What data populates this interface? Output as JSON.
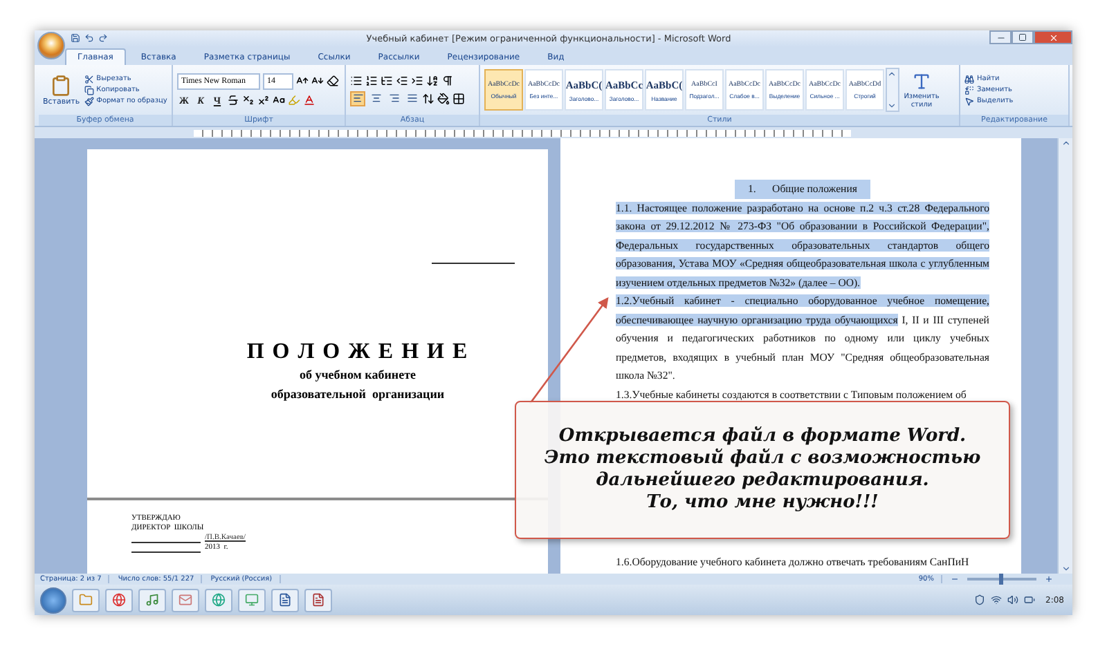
{
  "window": {
    "title": "Учебный кабинет [Режим ограниченной функциональности] - Microsoft Word"
  },
  "tabs": [
    {
      "label": "Главная",
      "selected": true
    },
    {
      "label": "Вставка",
      "selected": false
    },
    {
      "label": "Разметка страницы",
      "selected": false
    },
    {
      "label": "Ссылки",
      "selected": false
    },
    {
      "label": "Рассылки",
      "selected": false
    },
    {
      "label": "Рецензирование",
      "selected": false
    },
    {
      "label": "Вид",
      "selected": false
    }
  ],
  "ribbon": {
    "clipboard": {
      "paste": "Вставить",
      "cut": "Вырезать",
      "copy": "Копировать",
      "format_painter": "Формат по образцу",
      "label": "Буфер обмена"
    },
    "font": {
      "font_name": "Times New Roman",
      "font_size": "14",
      "bold": "Ж",
      "italic": "К",
      "underline": "Ч",
      "label": "Шрифт"
    },
    "paragraph": {
      "align_buttons": [
        {
          "kind": "left",
          "selected": true
        },
        {
          "kind": "center",
          "selected": false
        },
        {
          "kind": "right",
          "selected": false
        },
        {
          "kind": "justify",
          "selected": false
        }
      ],
      "label": "Абзац"
    },
    "styles": {
      "items": [
        {
          "preview": "AaBbCcDc",
          "name": "Обычный",
          "kind": "body",
          "selected": true
        },
        {
          "preview": "AaBbCcDc",
          "name": "Без инте...",
          "kind": "body",
          "selected": false
        },
        {
          "preview": "AaBbC(",
          "name": "Заголово...",
          "kind": "heading",
          "selected": false
        },
        {
          "preview": "AaBbCc",
          "name": "Заголово...",
          "kind": "heading",
          "selected": false
        },
        {
          "preview": "AaBbC(",
          "name": "Название",
          "kind": "heading",
          "selected": false
        },
        {
          "preview": "AaBbCcI",
          "name": "Подзагол...",
          "kind": "body",
          "selected": false
        },
        {
          "preview": "AaBbCcDc",
          "name": "Слабое в...",
          "kind": "body",
          "selected": false
        },
        {
          "preview": "AaBbCcDc",
          "name": "Выделение",
          "kind": "body",
          "selected": false
        },
        {
          "preview": "AaBbCcDc",
          "name": "Сильное ...",
          "kind": "body",
          "selected": false
        },
        {
          "preview": "AaBbCcDd",
          "name": "Строгий",
          "kind": "body",
          "selected": false
        }
      ],
      "change_styles": "Изменить стили",
      "label": "Стили"
    },
    "editing": {
      "find": "Найти",
      "replace": "Заменить",
      "select": "Выделить",
      "label": "Редактирование"
    }
  },
  "left_page": {
    "title": "П О Л О Ж Е Н И Е",
    "subtitle_lines": [
      "об учебном кабинете",
      "образовательной  организации"
    ],
    "approval_lines": [
      "УТВЕРЖДАЮ",
      "ДИРЕКТОР  ШКОЛЫ"
    ],
    "signature": "/П.В.Качаев/",
    "year": "2013  г."
  },
  "right_page": {
    "heading": "1.      Общие положения",
    "heading_selected": true,
    "paragraphs": [
      {
        "runs": [
          {
            "text": "1.1. Настоящее положение разработано на основе п.2  ч.3 ст.28  Федерального закона от 29.12.2012     № 273-ФЗ \"Об образовании в Российской Федерации\", Федеральных государственных образовательных стандартов общего образования, Устава МОУ «Средняя общеобразовательная школа с углубленным изучением отдельных предметов №32» (далее – ОО).",
            "selected": true
          }
        ]
      },
      {
        "runs": [
          {
            "text": "1.2.Учебный кабинет - специально оборудованное учебное помещение, обеспечивающее научную организацию труда обучающихся",
            "selected": true
          },
          {
            "text": " I, II и III ступеней обучения и педагогических работников по одному или циклу учебных предметов, входящих в учебный план МОУ \"Средняя общеобразовательная школа №32\".",
            "selected": false
          }
        ]
      },
      {
        "runs": [
          {
            "text": "1.3.Учебные кабинеты создаются в соответствии с Типовым положением об",
            "selected": false
          }
        ]
      }
    ],
    "last_paragraph": "1.6.Оборудование учебного кабинета должно отвечать требованиям СанПиН"
  },
  "callout": {
    "lines": [
      "Открывается файл в формате Word.",
      "Это текстовый файл с возможностью",
      "дальнейшего редактирования.",
      "То, что мне нужно!!!"
    ]
  },
  "status_bar": {
    "page": "Страница: 2 из 7",
    "words": "Число слов: 55/1 227",
    "language": "Русский (Россия)",
    "zoom": "90%",
    "zoom_slider": {
      "level": 0.45
    }
  },
  "taskbar": {
    "clock": "2:08"
  }
}
